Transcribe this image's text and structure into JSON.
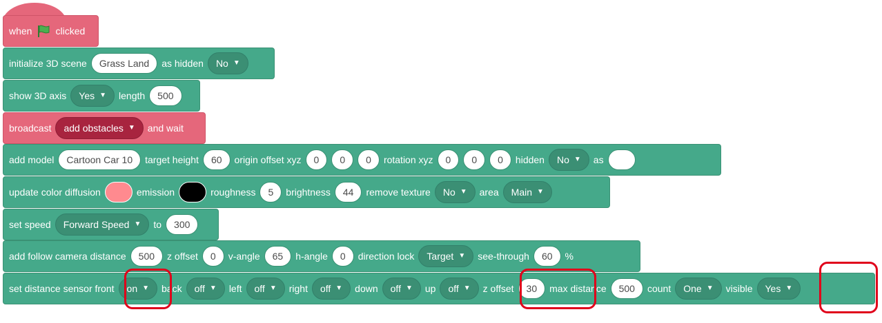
{
  "blocks": {
    "when_clicked": {
      "prefix": "when",
      "suffix": "clicked"
    },
    "init_scene": {
      "label": "initialize 3D scene",
      "scene": "Grass Land",
      "as_hidden_label": "as hidden",
      "hidden_value": "No"
    },
    "show_axis": {
      "label": "show 3D axis",
      "value": "Yes",
      "length_label": "length",
      "length": "500"
    },
    "broadcast": {
      "label": "broadcast",
      "message": "add obstacles",
      "suffix": "and wait"
    },
    "add_model": {
      "label": "add model",
      "model": "Cartoon Car 10",
      "target_height_label": "target height",
      "target_height": "60",
      "origin_label": "origin offset xyz",
      "origin_x": "0",
      "origin_y": "0",
      "origin_z": "0",
      "rotation_label": "rotation xyz",
      "rot_x": "0",
      "rot_y": "0",
      "rot_z": "0",
      "hidden_label": "hidden",
      "hidden_value": "No",
      "as_label": "as",
      "as_value": ""
    },
    "update_color": {
      "label": "update color diffusion",
      "diffusion_color": "#ff8a8f",
      "emission_label": "emission",
      "emission_color": "#000000",
      "roughness_label": "roughness",
      "roughness": "5",
      "brightness_label": "brightness",
      "brightness": "44",
      "remove_texture_label": "remove texture",
      "remove_texture": "No",
      "area_label": "area",
      "area": "Main"
    },
    "set_speed": {
      "label": "set speed",
      "speed_type": "Forward Speed",
      "to_label": "to",
      "value": "300"
    },
    "follow_camera": {
      "label": "add follow camera distance",
      "distance": "500",
      "z_offset_label": "z offset",
      "z_offset": "0",
      "v_angle_label": "v-angle",
      "v_angle": "65",
      "h_angle_label": "h-angle",
      "h_angle": "0",
      "direction_lock_label": "direction lock",
      "direction_lock": "Target",
      "see_through_label": "see-through",
      "see_through": "60",
      "percent": "%"
    },
    "distance_sensor": {
      "label": "set distance sensor front",
      "front": "on",
      "back_label": "back",
      "back": "off",
      "left_label": "left",
      "left": "off",
      "right_label": "right",
      "right": "off",
      "down_label": "down",
      "down": "off",
      "up_label": "up",
      "up": "off",
      "z_offset_label": "z offset",
      "z_offset": "30",
      "max_distance_label": "max distance",
      "max_distance": "500",
      "count_label": "count",
      "count": "One",
      "visible_label": "visible",
      "visible": "Yes"
    }
  },
  "colors": {
    "event_block": "#e5677b",
    "motion_block": "#45a98a",
    "dropdown_dark": "#3b8f74",
    "broadcast_dropdown": "#a8243f",
    "highlight": "#e0001a",
    "flag": "#4caf50"
  },
  "icons": {
    "flag": "green-flag-icon",
    "caret": "caret-down-icon"
  }
}
